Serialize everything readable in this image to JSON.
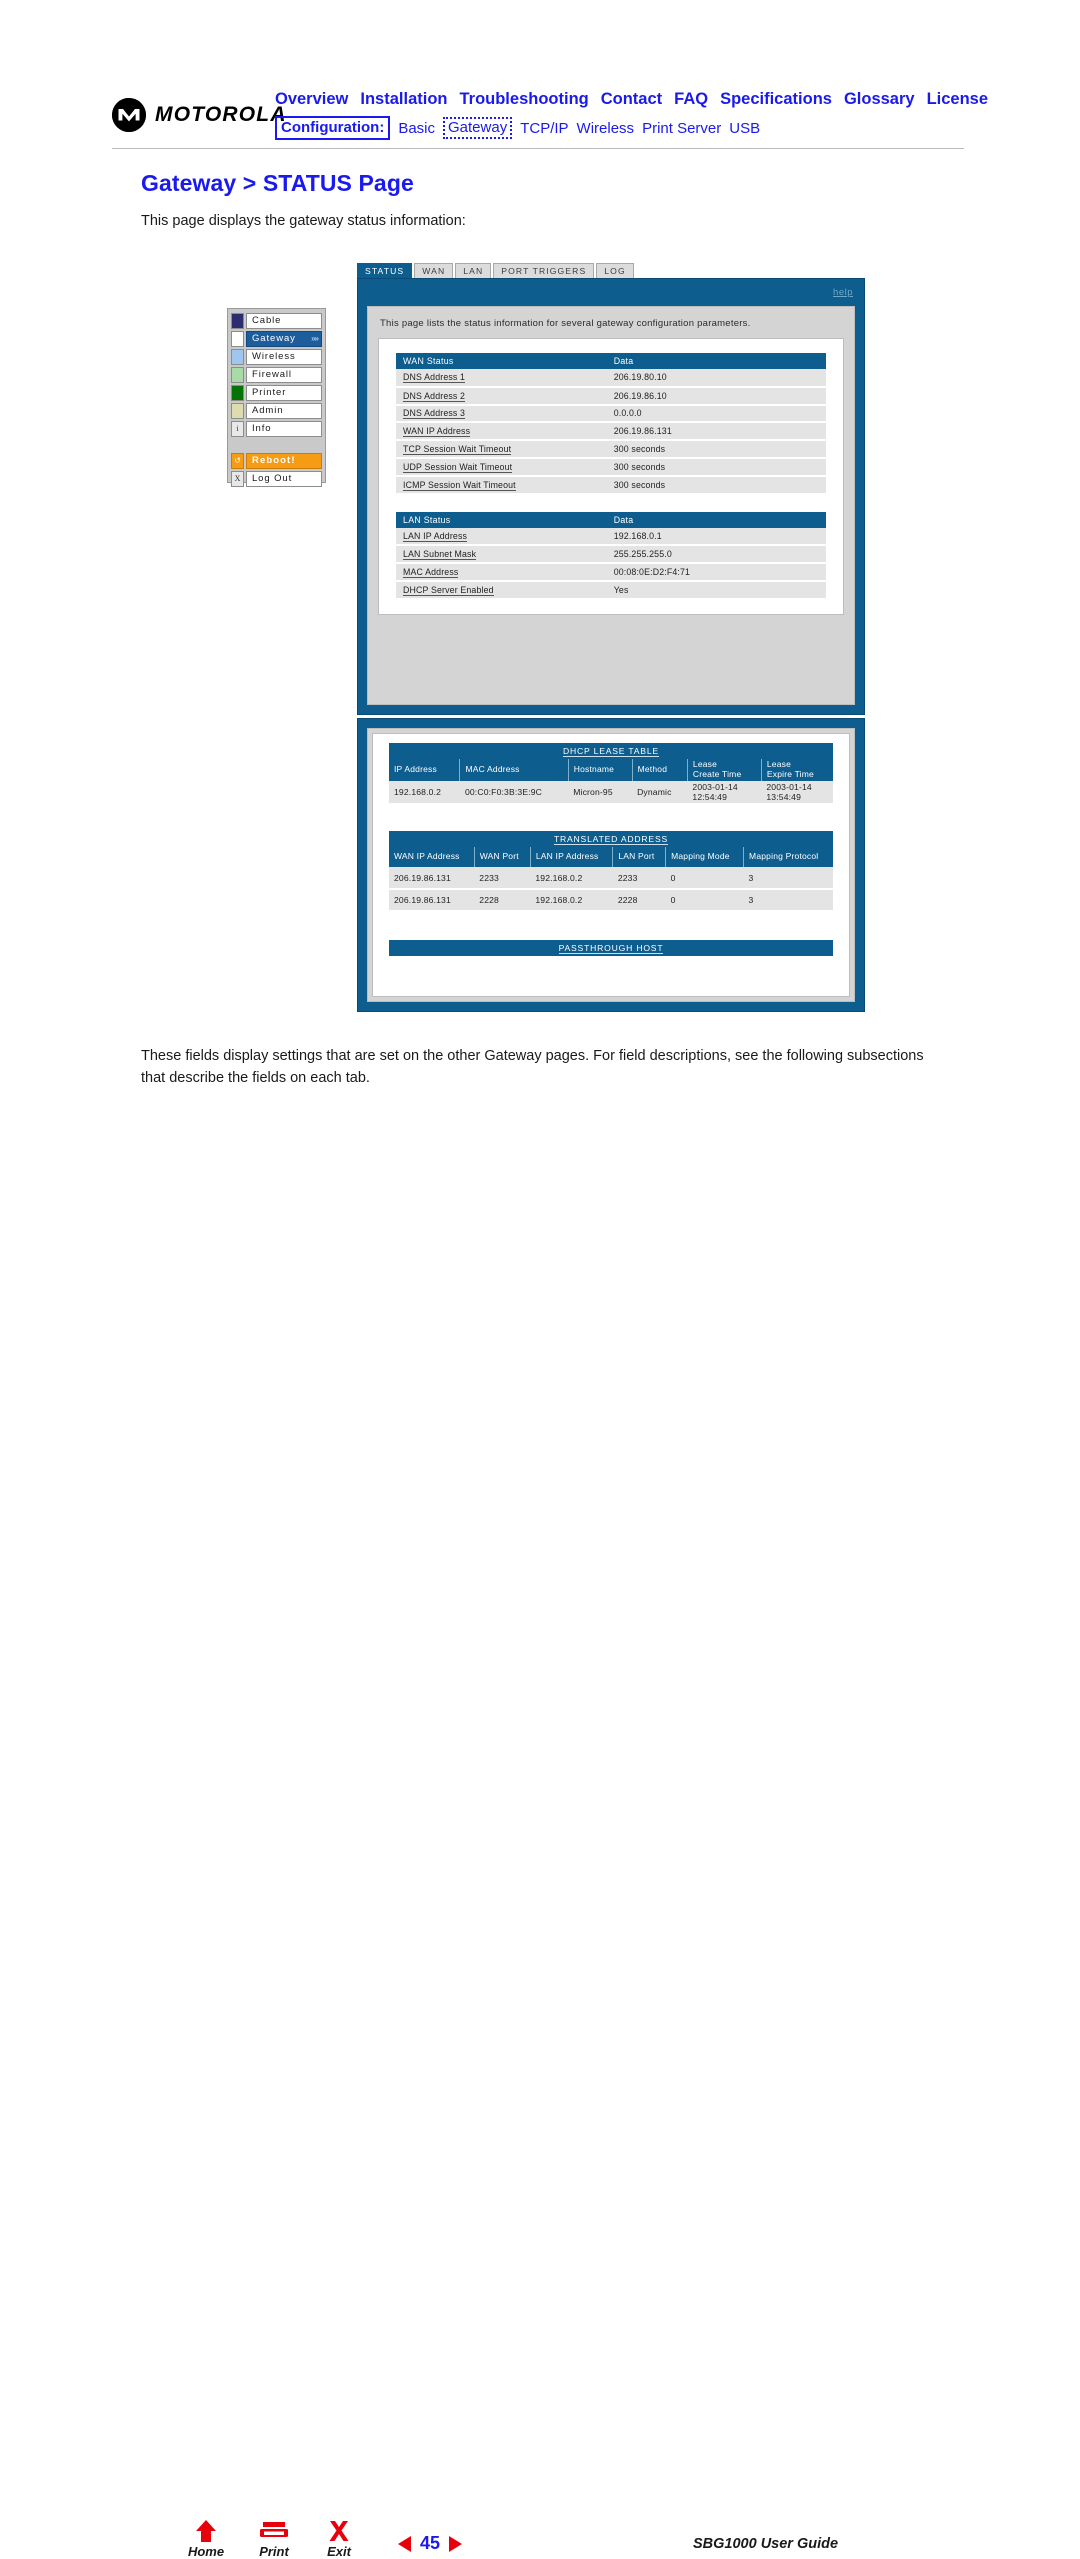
{
  "brand": {
    "logo_text": "MOTOROLA",
    "logo_icon": "motorola-m-logo"
  },
  "topnav": {
    "primary": [
      "Overview",
      "Installation",
      "Troubleshooting",
      "Contact",
      "FAQ",
      "Specifications",
      "Glossary",
      "License"
    ],
    "config_label": "Configuration:",
    "secondary": [
      "Basic",
      "Gateway",
      "TCP/IP",
      "Wireless",
      "Print Server",
      "USB"
    ],
    "secondary_active": "Gateway",
    "link_color": "#1a1aee"
  },
  "page": {
    "title": "Gateway > STATUS Page",
    "intro": "This page displays the gateway status information:",
    "closing": "These fields display settings that are set on the other Gateway pages. For field descriptions, see the following subsections that describe the fields on each tab."
  },
  "sidebar": {
    "items": [
      {
        "label": "Cable",
        "swatch": "#2c2c6e",
        "icon": "square-icon"
      },
      {
        "label": "Gateway",
        "swatch": "#ffffff",
        "icon": "square-icon",
        "selected": true,
        "arrow": "»»"
      },
      {
        "label": "Wireless",
        "swatch": "#9fc6ef",
        "icon": "square-icon"
      },
      {
        "label": "Firewall",
        "swatch": "#a8dba8",
        "icon": "square-icon"
      },
      {
        "label": "Printer",
        "swatch": "#067306",
        "icon": "square-icon"
      },
      {
        "label": "Admin",
        "swatch": "#dcdcae",
        "icon": "square-icon"
      },
      {
        "label": "Info",
        "swatch": "",
        "icon": "info-icon",
        "glyph": "i"
      }
    ],
    "reboot": {
      "label": "Reboot!",
      "glyph": "↺",
      "icon": "reboot-icon",
      "color": "#f59b14"
    },
    "logout": {
      "label": "Log Out",
      "glyph": "X",
      "icon": "close-icon"
    }
  },
  "router": {
    "tabs": [
      {
        "label": "STATUS",
        "active": true
      },
      {
        "label": "WAN",
        "active": false
      },
      {
        "label": "LAN",
        "active": false
      },
      {
        "label": "PORT TRIGGERS",
        "active": false
      },
      {
        "label": "LOG",
        "active": false
      }
    ],
    "help_label": "help",
    "description": "This page lists the status information for several gateway configuration parameters.",
    "header_color": "#0d5d8f",
    "wan_status": {
      "headers": [
        "WAN Status",
        "Data"
      ],
      "rows": [
        [
          "DNS Address 1",
          "206.19.80.10"
        ],
        [
          "DNS Address 2",
          "206.19.86.10"
        ],
        [
          "DNS Address 3",
          "0.0.0.0"
        ],
        [
          "WAN IP Address",
          "206.19.86.131"
        ],
        [
          "TCP Session Wait Timeout",
          "300 seconds"
        ],
        [
          "UDP Session Wait Timeout",
          "300 seconds"
        ],
        [
          "ICMP Session Wait Timeout",
          "300 seconds"
        ]
      ]
    },
    "lan_status": {
      "headers": [
        "LAN Status",
        "Data"
      ],
      "rows": [
        [
          "LAN IP Address",
          "192.168.0.1"
        ],
        [
          "LAN Subnet Mask",
          "255.255.255.0"
        ],
        [
          "MAC Address",
          "00:08:0E:D2:F4:71"
        ],
        [
          "DHCP Server Enabled",
          "Yes"
        ]
      ]
    },
    "dhcp_lease_table": {
      "title": "DHCP LEASE TABLE",
      "columns": [
        "IP Address",
        "MAC Address",
        "Hostname",
        "Method",
        "Lease\nCreate Time",
        "Lease\nExpire Time"
      ],
      "columns_flat": [
        "IP Address",
        "MAC Address",
        "Hostname",
        "Method",
        "Lease Create Time",
        "Lease Expire Time"
      ],
      "rows": [
        [
          "192.168.0.2",
          "00:C0:F0:3B:3E:9C",
          "Micron-95",
          "Dynamic",
          "2003-01-14 12:54:49",
          "2003-01-14 13:54:49"
        ]
      ]
    },
    "translated_address": {
      "title": "TRANSLATED ADDRESS",
      "columns": [
        "WAN IP Address",
        "WAN Port",
        "LAN IP Address",
        "LAN Port",
        "Mapping Mode",
        "Mapping Protocol"
      ],
      "rows": [
        [
          "206.19.86.131",
          "2233",
          "192.168.0.2",
          "2233",
          "0",
          "3"
        ],
        [
          "206.19.86.131",
          "2228",
          "192.168.0.2",
          "2228",
          "0",
          "3"
        ]
      ]
    },
    "passthrough_host": {
      "title": "PASSTHROUGH HOST"
    }
  },
  "footer": {
    "buttons": [
      {
        "label": "Home",
        "icon": "home-arrow-icon"
      },
      {
        "label": "Print",
        "icon": "printer-icon"
      },
      {
        "label": "Exit",
        "icon": "exit-x-icon"
      }
    ],
    "page_number": "45",
    "prev_icon": "prev-triangle-icon",
    "next_icon": "next-triangle-icon",
    "guide_name": "SBG1000 User Guide",
    "accent_red": "#e8000b",
    "accent_blue": "#1a1aee"
  }
}
